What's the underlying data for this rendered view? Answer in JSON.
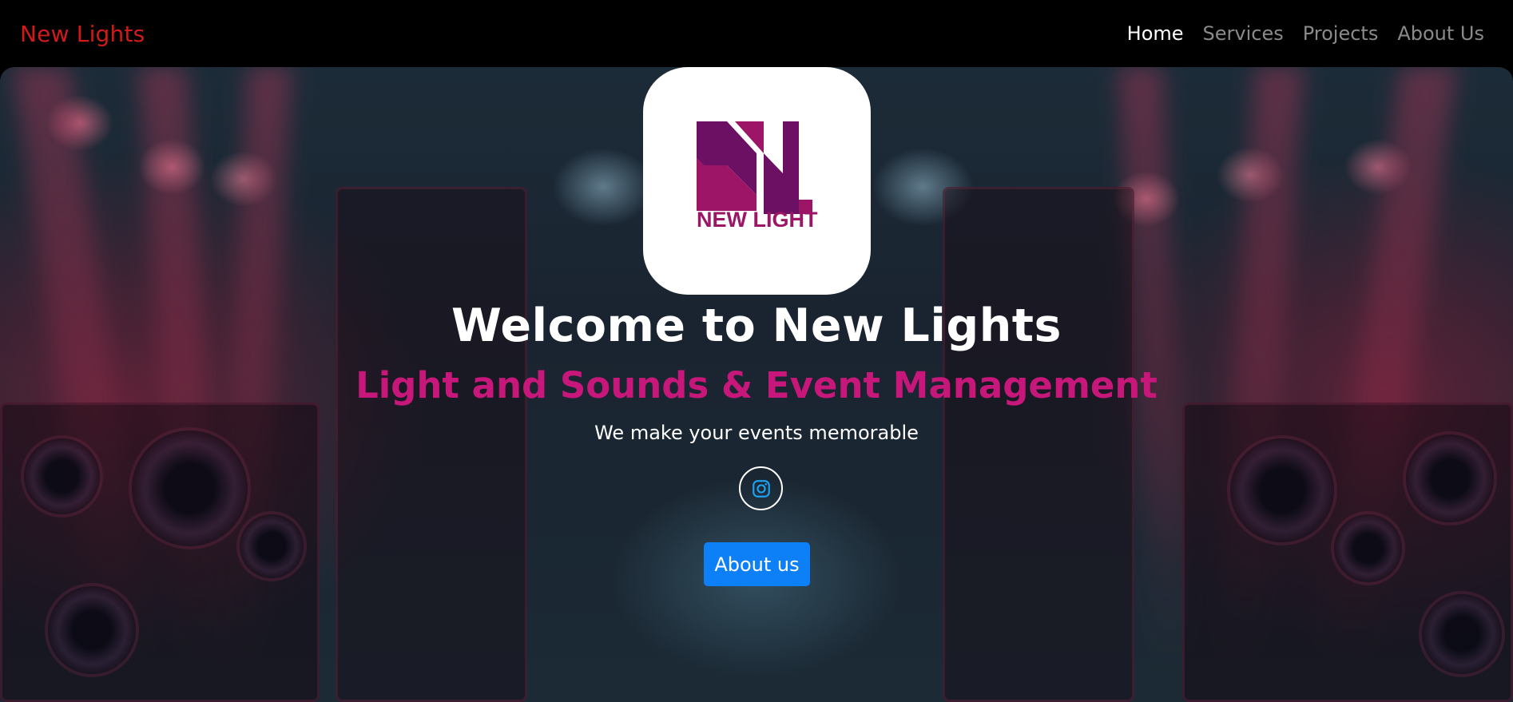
{
  "navbar": {
    "brand": "New Lights",
    "links": [
      {
        "label": "Home",
        "active": true
      },
      {
        "label": "Services",
        "active": false
      },
      {
        "label": "Projects",
        "active": false
      },
      {
        "label": "About Us",
        "active": false
      }
    ]
  },
  "hero": {
    "logo_text": "NEW LIGHT",
    "title": "Welcome to New Lights",
    "subtitle": "Light and Sounds & Event Management",
    "tagline": "We make your events memorable",
    "social": {
      "icon": "instagram-icon"
    },
    "cta_label": "About us"
  },
  "colors": {
    "brand": "#d11a1a",
    "accent_pink": "#c7177a",
    "logo_purple": "#6b1063",
    "logo_magenta": "#9c1566",
    "button_blue": "#0d7ff7",
    "instagram_icon": "#1da1f2"
  }
}
